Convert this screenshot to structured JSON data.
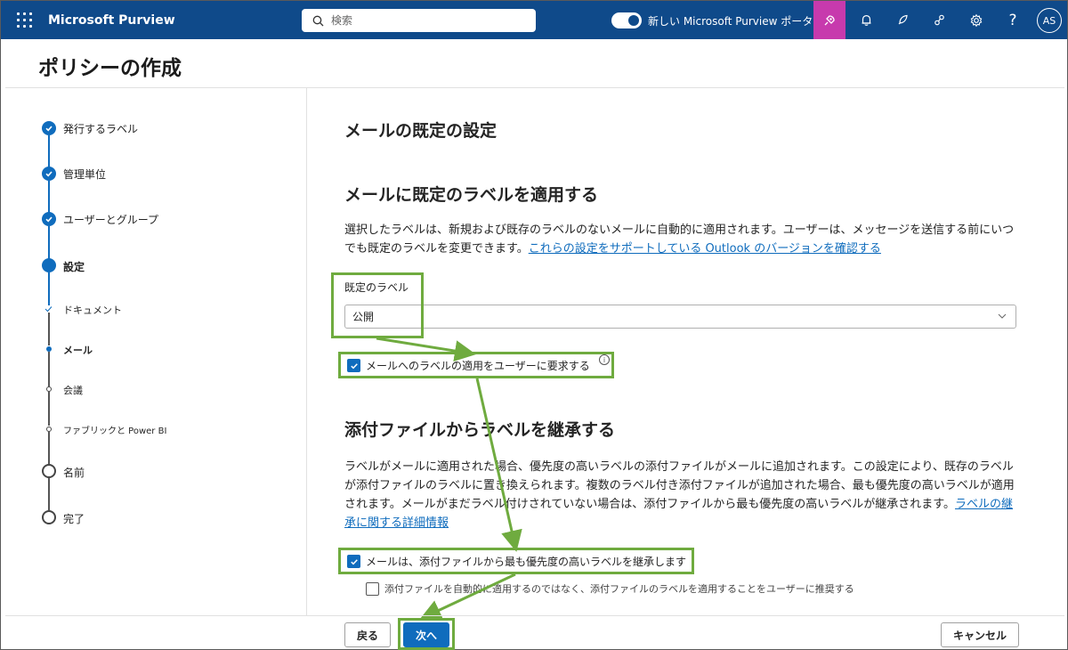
{
  "app": {
    "brand": "Microsoft Purview",
    "search_placeholder": "検索",
    "toggle_label": "新しい Microsoft Purview ポータル",
    "avatar_initials": "AS"
  },
  "page": {
    "title": "ポリシーの作成"
  },
  "steps": [
    {
      "label": "発行するラベル",
      "state": "done"
    },
    {
      "label": "管理単位",
      "state": "done"
    },
    {
      "label": "ユーザーとグループ",
      "state": "done"
    },
    {
      "label": "設定",
      "state": "current"
    },
    {
      "label": "ドキュメント",
      "state": "sub-done"
    },
    {
      "label": "メール",
      "state": "sub-current"
    },
    {
      "label": "会議",
      "state": "sub-pending"
    },
    {
      "label": "ファブリックと Power BI",
      "state": "sub-pending"
    },
    {
      "label": "名前",
      "state": "pending"
    },
    {
      "label": "完了",
      "state": "pending"
    }
  ],
  "main": {
    "heading": "メールの既定の設定",
    "section1": {
      "title": "メールに既定のラベルを適用する",
      "description": "選択したラベルは、新規および既存のラベルのないメールに自動的に適用されます。ユーザーは、メッセージを送信する前にいつでも既定のラベルを変更できます。",
      "link": "これらの設定をサポートしている Outlook のバージョンを確認する",
      "default_label_title": "既定のラベル",
      "default_label_value": "公開",
      "require_label_checkbox": "メールへのラベルの適用をユーザーに要求する",
      "require_label_checked": true
    },
    "section2": {
      "title": "添付ファイルからラベルを継承する",
      "description": "ラベルがメールに適用された場合、優先度の高いラベルの添付ファイルがメールに追加されます。この設定により、既存のラベルが添付ファイルのラベルに置き換えられます。複数のラベル付き添付ファイルが追加された場合、最も優先度の高いラベルが適用されます。メールがまだラベル付けされていない場合は、添付ファイルから最も優先度の高いラベルが継承されます。",
      "link": "ラベルの継承に関する詳細情報",
      "inherit_checkbox": "メールは、添付ファイルから最も優先度の高いラベルを継承します",
      "inherit_checked": true,
      "recommend_checkbox": "添付ファイルを自動的に適用するのではなく、添付ファイルのラベルを適用することをユーザーに推奨する",
      "recommend_checked": false
    }
  },
  "footer": {
    "back": "戻る",
    "next": "次へ",
    "cancel": "キャンセル"
  },
  "colors": {
    "topbar": "#0f4a8a",
    "accent": "#0f6cbd",
    "highlight": "#6fab3f",
    "active_icon_bg": "#c73aad"
  }
}
